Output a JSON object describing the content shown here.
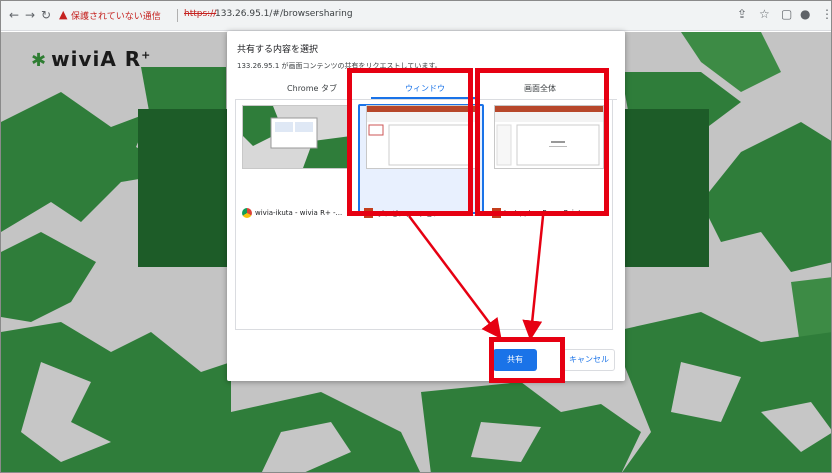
{
  "browser": {
    "security_warning": "保護されていない通信",
    "url_scheme": "https://",
    "url_rest": "133.26.95.1/#/browsersharing"
  },
  "app": {
    "logo_text": "wiviA R",
    "logo_sup": "+"
  },
  "dialog": {
    "title": "共有する内容を選択",
    "subtitle": "133.26.95.1 が画面コンテンツの共有をリクエストしています。",
    "tabs": [
      {
        "label": "Chrome タブ",
        "active": false
      },
      {
        "label": "ウィンドウ",
        "active": true
      },
      {
        "label": "画面全体",
        "active": false
      }
    ],
    "items": [
      {
        "label": "wivia-ikuta - wivia R+ -..."
      },
      {
        "label": "プレゼンテーション1 - Powe..."
      },
      {
        "label": "test.pptx - PowerPoint"
      }
    ],
    "share_label": "共有",
    "cancel_label": "キャンセル"
  },
  "colors": {
    "accent": "#1a73e8",
    "highlight": "#e60012",
    "brand_green": "#2e7d32"
  }
}
